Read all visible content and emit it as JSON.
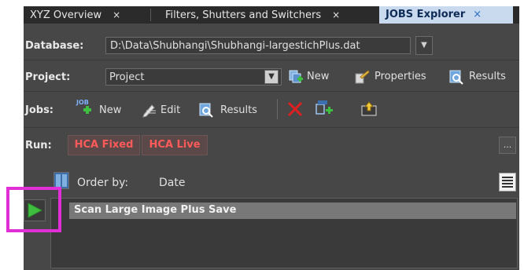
{
  "tabs": [
    {
      "label": "XYZ Overview",
      "close": "×"
    },
    {
      "label": "Filters, Shutters and Switchers",
      "close": "×"
    },
    {
      "label": "JOBS Explorer",
      "close": "×"
    }
  ],
  "database": {
    "label": "Database:",
    "value": "D:\\Data\\Shubhangi\\Shubhangi-largestichPlus.dat"
  },
  "project": {
    "label": "Project:",
    "value": "Project",
    "new_label": "New",
    "properties_label": "Properties",
    "results_label": "Results"
  },
  "jobs": {
    "label": "Jobs:",
    "new_label": "New",
    "edit_label": "Edit",
    "results_label": "Results",
    "job_badge": "JOB"
  },
  "run": {
    "label": "Run:",
    "buttons": [
      "HCA Fixed",
      "HCA Live"
    ],
    "more": "..."
  },
  "order": {
    "label": "Order by:",
    "value": "Date"
  },
  "job_list": [
    "Scan Large Image Plus Save"
  ],
  "colors": {
    "accent_red": "#ff5a5a",
    "highlight": "#e12ed6",
    "tab_active_bg": "#c9d9ee",
    "panel_bg": "#474747"
  }
}
